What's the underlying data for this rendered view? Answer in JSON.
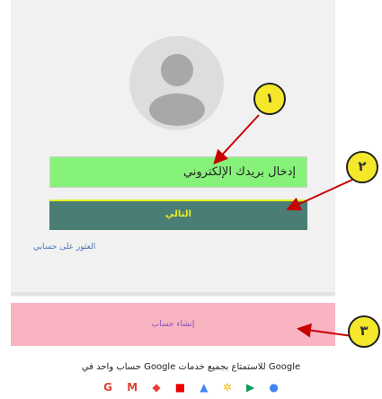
{
  "form": {
    "email_placeholder": "إدخال بريدك الإلكتروني",
    "next_label": "التالي",
    "find_account_link": "العثور على حسابي"
  },
  "create_account": {
    "label": "إنشاء حساب"
  },
  "footer": {
    "tagline": "حساب واحد في Google للاستمتاع بجميع خدمات Google",
    "service_icons": [
      "gmail-icon",
      "maps-icon",
      "youtube-icon",
      "drive-icon",
      "photos-icon",
      "play-icon",
      "chrome-icon"
    ]
  },
  "annotations": [
    {
      "label": "١"
    },
    {
      "label": "٢"
    },
    {
      "label": "٣"
    }
  ],
  "colors": {
    "email_fill": "#86f27a",
    "next_fill": "#4a7d73",
    "next_text": "#e8ee20",
    "create_fill": "#f8b5c1",
    "marker_fill": "#f5e82a",
    "arrow": "#c80000"
  }
}
